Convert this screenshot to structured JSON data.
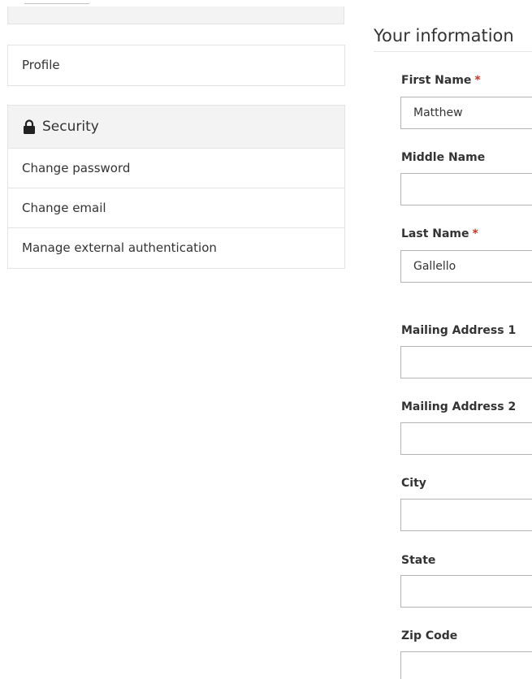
{
  "sidebar": {
    "profile_label": "Profile",
    "security": {
      "heading": "Security",
      "icon": "lock-icon",
      "items": [
        {
          "label": "Change password"
        },
        {
          "label": "Change email"
        },
        {
          "label": "Manage external authentication"
        }
      ]
    }
  },
  "form": {
    "title": "Your information",
    "required_marker": "*",
    "fields": {
      "first_name": {
        "label": "First Name",
        "value": "Matthew",
        "required": true
      },
      "middle_name": {
        "label": "Middle Name",
        "value": "",
        "required": false
      },
      "last_name": {
        "label": "Last Name",
        "value": "Gallello",
        "required": true
      },
      "mailing_address_1": {
        "label": "Mailing Address 1",
        "value": "",
        "required": false
      },
      "mailing_address_2": {
        "label": "Mailing Address 2",
        "value": "",
        "required": false
      },
      "city": {
        "label": "City",
        "value": "",
        "required": false
      },
      "state": {
        "label": "State",
        "value": "",
        "required": false
      },
      "zip_code": {
        "label": "Zip Code",
        "value": "",
        "required": false
      }
    }
  },
  "colors": {
    "required": "#c0392b",
    "panel_bg": "#f3f3f3",
    "border": "#e3e3e3"
  }
}
